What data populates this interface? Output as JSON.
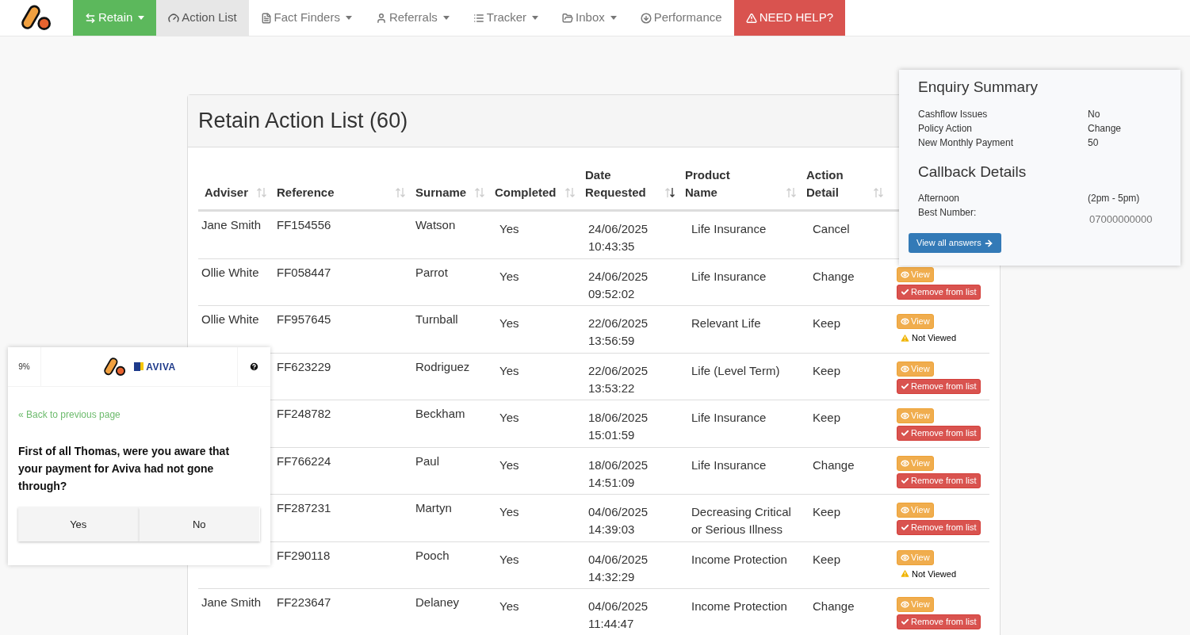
{
  "nav": [
    {
      "label": "Retain",
      "selected": true,
      "dropdown": true,
      "kind": "normal"
    },
    {
      "label": "Action List",
      "selected": false,
      "dropdown": false,
      "kind": "current"
    },
    {
      "label": "Fact Finders",
      "selected": false,
      "dropdown": true,
      "kind": "normal"
    },
    {
      "label": "Referrals",
      "selected": false,
      "dropdown": true,
      "kind": "normal"
    },
    {
      "label": "Tracker",
      "selected": false,
      "dropdown": true,
      "kind": "normal"
    },
    {
      "label": "Inbox",
      "selected": false,
      "dropdown": true,
      "kind": "normal"
    },
    {
      "label": "Performance",
      "selected": false,
      "dropdown": false,
      "kind": "normal"
    },
    {
      "label": "NEED HELP?",
      "selected": false,
      "dropdown": false,
      "kind": "alert"
    }
  ],
  "panel": {
    "title": "Retain Action List (60)"
  },
  "table": {
    "columns": [
      {
        "label": "Adviser",
        "sorted": false
      },
      {
        "label": "Reference",
        "sorted": false
      },
      {
        "label": "Surname",
        "sorted": false
      },
      {
        "label": "Completed",
        "sorted": false
      },
      {
        "label": "Date Requested",
        "sorted": true
      },
      {
        "label": "Product Name",
        "sorted": false
      },
      {
        "label": "Action Detail",
        "sorted": false
      }
    ],
    "rows": [
      {
        "adviser": "Jane Smith",
        "reference": "FF154556",
        "surname": "Watson",
        "completed": "Yes",
        "date": "24/06/2025",
        "time": "10:43:35",
        "product": "Life Insurance",
        "action": "Cancel"
      },
      {
        "adviser": "Ollie White",
        "reference": "FF058447",
        "surname": "Parrot",
        "completed": "Yes",
        "date": "24/06/2025",
        "time": "09:52:02",
        "product": "Life Insurance",
        "action": "Change",
        "view": "View",
        "status": {
          "kind": "remove",
          "label": "Remove from list"
        }
      },
      {
        "adviser": "Ollie White",
        "reference": "FF957645",
        "surname": "Turnball",
        "completed": "Yes",
        "date": "22/06/2025",
        "time": "13:56:59",
        "product": "Relevant Life",
        "action": "Keep",
        "view": "View",
        "status": {
          "kind": "not_viewed",
          "label": "Not Viewed"
        }
      },
      {
        "reference": "FF623229",
        "surname": "Rodriguez",
        "completed": "Yes",
        "date": "22/06/2025",
        "time": "13:53:22",
        "product": "Life (Level Term)",
        "action": "Keep",
        "view": "View",
        "status": {
          "kind": "remove",
          "label": "Remove from list"
        }
      },
      {
        "reference": "FF248782",
        "surname": "Beckham",
        "completed": "Yes",
        "date": "18/06/2025",
        "time": "15:01:59",
        "product": "Life Insurance",
        "action": "Keep",
        "view": "View",
        "status": {
          "kind": "remove",
          "label": "Remove from list"
        }
      },
      {
        "reference": "FF766224",
        "surname": "Paul",
        "completed": "Yes",
        "date": "18/06/2025",
        "time": "14:51:09",
        "product": "Life Insurance",
        "action": "Change",
        "view": "View",
        "status": {
          "kind": "remove",
          "label": "Remove from list"
        }
      },
      {
        "reference": "FF287231",
        "surname": "Martyn",
        "completed": "Yes",
        "date": "04/06/2025",
        "time": "14:39:03",
        "product": "Decreasing Critical or Serious Illness",
        "action": "Keep",
        "view": "View",
        "status": {
          "kind": "remove",
          "label": "Remove from list"
        }
      },
      {
        "reference": "FF290118",
        "surname": "Pooch",
        "completed": "Yes",
        "date": "04/06/2025",
        "time": "14:32:29",
        "product": "Income Protection",
        "action": "Keep",
        "view": "View",
        "status": {
          "kind": "not_viewed",
          "label": "Not Viewed"
        }
      },
      {
        "adviser": "Jane Smith",
        "reference": "FF223647",
        "surname": "Delaney",
        "completed": "Yes",
        "date": "04/06/2025",
        "time": "11:44:47",
        "product": "Income Protection",
        "action": "Change",
        "view": "View",
        "status": {
          "kind": "remove",
          "label": "Remove from list"
        }
      }
    ]
  },
  "summary": {
    "sections": [
      {
        "title": "Enquiry Summary",
        "rows": [
          {
            "label": "Cashflow Issues",
            "value": "No"
          },
          {
            "label": "Policy Action",
            "value": "Change"
          },
          {
            "label": "New Monthly Payment",
            "value": "50"
          }
        ]
      },
      {
        "title": "Callback Details",
        "rows": [
          {
            "label": "Afternoon",
            "value": "(2pm - 5pm)"
          },
          {
            "label": "Best Number:",
            "value": "07000000000"
          }
        ]
      }
    ],
    "button": "View all answers"
  },
  "widget": {
    "progress": "9%",
    "brand": "AVIVA",
    "back_link": "« Back to previous page",
    "question": "First of all Thomas, were you aware that your payment for Aviva had not gone through?",
    "answers": [
      "Yes",
      "No"
    ]
  }
}
